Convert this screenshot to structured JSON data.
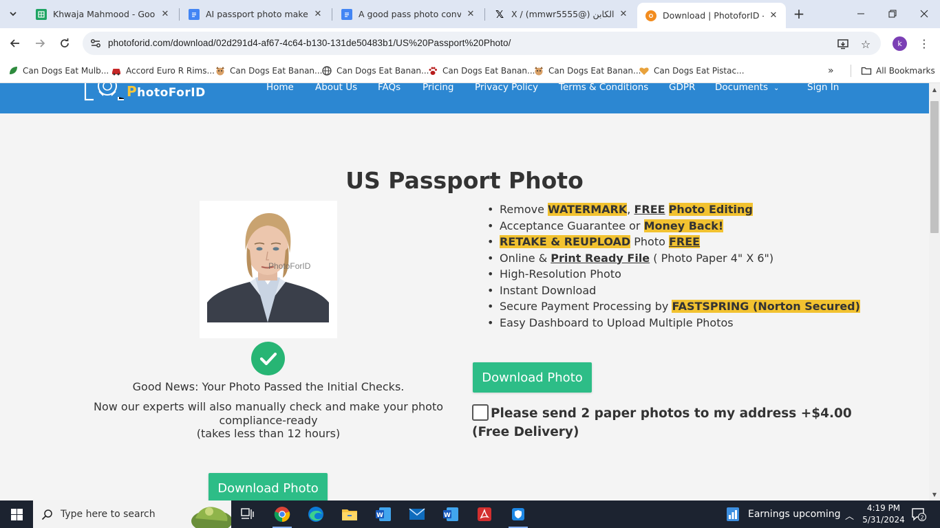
{
  "browser": {
    "tabs": [
      {
        "title": "Khwaja Mahmood - Google",
        "icon": "google-sheets-icon",
        "color": "#1fa463"
      },
      {
        "title": "AI passport photo maker fre",
        "icon": "google-docs-icon",
        "color": "#4285f4"
      },
      {
        "title": "A good pass photo converte",
        "icon": "google-docs-icon",
        "color": "#4285f4"
      },
      {
        "title": "X / (mmwr5555@) الكابن",
        "icon": "x-logo-icon",
        "color": "#000000"
      },
      {
        "title": "Download | PhotoforID - Pho",
        "icon": "photoforid-favicon",
        "color": "#f28c1e",
        "active": true
      }
    ],
    "url": "photoforid.com/download/02d291d4-af67-4c64-b130-131de50483b1/US%20Passport%20Photo/",
    "profile_initial": "k",
    "bookmarks": [
      "Can Dogs Eat Mulb...",
      "Accord Euro R Rims...",
      "Can Dogs Eat Banan...",
      "Can Dogs Eat Banan...",
      "Can Dogs Eat Banan...",
      "Can Dogs Eat Banan...",
      "Can Dogs Eat Pistac..."
    ],
    "all_bookmarks": "All Bookmarks"
  },
  "site": {
    "logo_text_first": "P",
    "logo_text_rest": "hotoForID",
    "nav": [
      "Home",
      "About Us",
      "FAQs",
      "Pricing",
      "Privacy Policy",
      "Terms & Conditions",
      "GDPR",
      "Documents",
      "Sign In"
    ],
    "brand_color": "#2c87d2",
    "accent_green": "#2dbd87",
    "highlight_yellow": "#f2c230"
  },
  "main": {
    "title": "US Passport Photo",
    "watermark": "PhotoForID",
    "features": {
      "f1": {
        "a": "Remove ",
        "b": "WATERMARK",
        "c": ", ",
        "d": "FREE",
        "e": " ",
        "f": "Photo Editing "
      },
      "f2": {
        "a": "Acceptance Guarantee or ",
        "b": "Money Back!"
      },
      "f3": {
        "a": "RETAKE & REUPLOAD",
        "b": " Photo ",
        "c": "FREE"
      },
      "f4": {
        "a": "Online & ",
        "b": "Print Ready File",
        "c": " ( Photo Paper 4\" X 6\")"
      },
      "f5": "High-Resolution Photo",
      "f6": "Instant Download",
      "f7": {
        "a": "Secure Payment Processing by ",
        "b": "FASTSPRING (Norton Secured)"
      },
      "f8": "Easy Dashboard to Upload Multiple Photos"
    },
    "good_news": "Good News: Your Photo Passed the Initial Checks.",
    "expert_line1": "Now our experts will also manually check and make your photo compliance-ready",
    "expert_line2": "(takes less than 12 hours)",
    "download_label": "Download Photo",
    "paper_option": "Please send 2 paper photos to my address +$4.00 (Free Delivery)"
  },
  "taskbar": {
    "search_placeholder": "Type here to search",
    "news": "Earnings upcoming",
    "time": "4:19 PM",
    "date": "5/31/2024",
    "notification_count": "2"
  }
}
